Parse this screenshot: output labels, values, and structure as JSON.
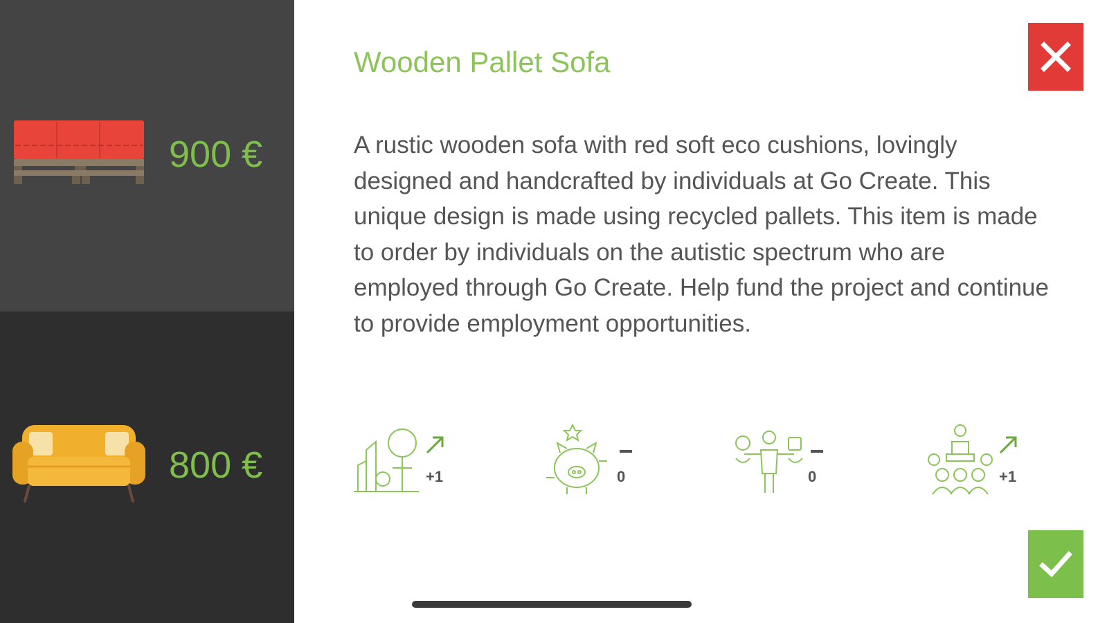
{
  "sidebar": {
    "options": [
      {
        "name": "Wooden Pallet Sofa",
        "price": "900 €",
        "selected": true
      },
      {
        "name": "Yellow Sofa",
        "price": "800 €",
        "selected": false
      }
    ]
  },
  "detail": {
    "title": "Wooden Pallet Sofa",
    "description": "A rustic wooden sofa with red soft eco cushions, lovingly designed and handcrafted by individuals at Go Create. This unique design is made using recycled pallets. This item is made to order by individuals on the autistic spectrum who are employed through Go Create. Help fund the project and continue to provide employment opportunities.",
    "close_icon": "close-icon",
    "confirm_icon": "checkmark-icon",
    "impacts": [
      {
        "icon": "environment-icon",
        "trend": "up",
        "value": "+1"
      },
      {
        "icon": "piggy-bank-icon",
        "trend": "flat",
        "value": "0"
      },
      {
        "icon": "balance-person-icon",
        "trend": "flat",
        "value": "0"
      },
      {
        "icon": "community-icon",
        "trend": "up",
        "value": "+1"
      }
    ]
  },
  "colors": {
    "accent_green": "#8cc45a",
    "close_red": "#e23b37",
    "confirm_green": "#7cc04b",
    "sidebar_dark": "#2e2e2e",
    "sidebar_selected": "#444444"
  }
}
